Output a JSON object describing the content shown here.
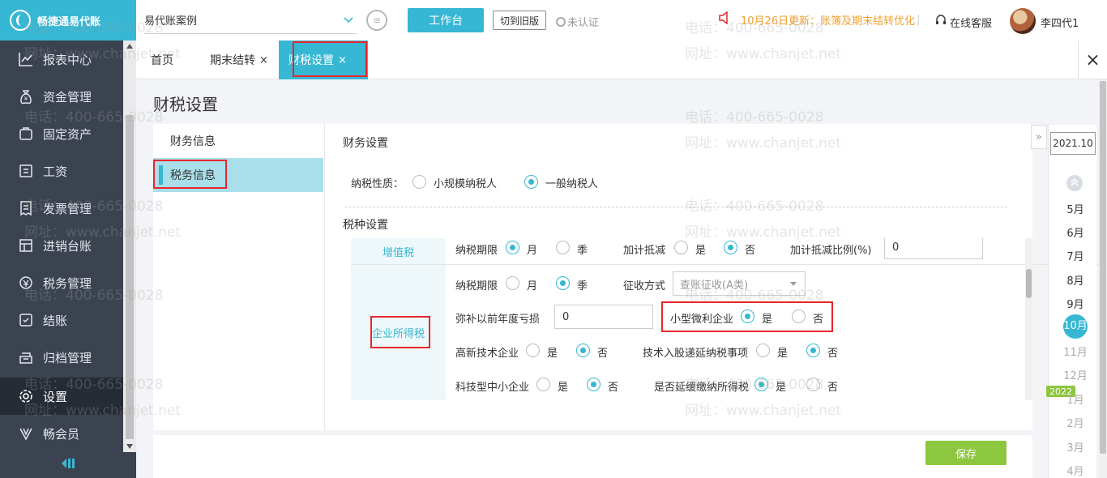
{
  "brand": {
    "name": "畅捷通易代账"
  },
  "sidebar": {
    "items": [
      {
        "label": "报表中心",
        "icon": "chart-icon"
      },
      {
        "label": "资金管理",
        "icon": "money-bag-icon"
      },
      {
        "label": "固定资产",
        "icon": "asset-icon"
      },
      {
        "label": "工资",
        "icon": "wallet-icon"
      },
      {
        "label": "发票管理",
        "icon": "invoice-icon"
      },
      {
        "label": "进销台账",
        "icon": "ledger-icon"
      },
      {
        "label": "税务管理",
        "icon": "tax-icon"
      },
      {
        "label": "结账",
        "icon": "checkout-icon"
      },
      {
        "label": "归档管理",
        "icon": "archive-icon"
      },
      {
        "label": "设置",
        "icon": "gear-icon"
      },
      {
        "label": "畅会员",
        "icon": "vip-icon"
      }
    ],
    "active_index": 9
  },
  "header": {
    "company": "易代账案例",
    "workbench": "工作台",
    "old_version": "切到旧版",
    "certification": "未认证",
    "notice": "10月26日更新：账簿及期末结转优化",
    "service": "在线客服",
    "user": "李四代1"
  },
  "tabs": [
    {
      "label": "首页",
      "closable": false
    },
    {
      "label": "期末结转",
      "closable": true
    },
    {
      "label": "财税设置",
      "closable": true,
      "active": true
    }
  ],
  "page": {
    "title": "财税设置",
    "subnav": [
      "财务信息",
      "税务信息"
    ],
    "subnav_active": 1
  },
  "finance": {
    "section_title": "财务设置",
    "taxpayer_label": "纳税性质：",
    "taxpayer_options": [
      "小规模纳税人",
      "一般纳税人"
    ],
    "taxpayer_selected": 1
  },
  "tax_section_title": "税种设置",
  "vat": {
    "name": "增值税",
    "period_label": "纳税期限",
    "period_options": [
      "月",
      "季"
    ],
    "period_selected": 0,
    "deduct_label": "加计抵减",
    "deduct_options": [
      "是",
      "否"
    ],
    "deduct_selected": 1,
    "ratio_label": "加计抵减比例(%)",
    "ratio_value": "0"
  },
  "cit": {
    "name": "企业所得税",
    "period_label": "纳税期限",
    "period_options": [
      "月",
      "季"
    ],
    "period_selected": 1,
    "method_label": "征收方式",
    "method_value": "查账征收(A类)",
    "loss_label": "弥补以前年度亏损",
    "loss_value": "0",
    "small_label": "小型微利企业",
    "small_options": [
      "是",
      "否"
    ],
    "small_selected": 0,
    "hitech_label": "高新技术企业",
    "hitech_options": [
      "是",
      "否"
    ],
    "hitech_selected": 1,
    "tech_equity_label": "技术入股递延纳税事项",
    "tech_equity_options": [
      "是",
      "否"
    ],
    "tech_equity_selected": 1,
    "sme_label": "科技型中小企业",
    "sme_options": [
      "是",
      "否"
    ],
    "sme_selected": 1,
    "defer_label": "是否延缓缴纳所得税",
    "defer_options": [
      "是",
      "否"
    ],
    "defer_selected": 0
  },
  "save_label": "保存",
  "period": {
    "current": "2021.10",
    "months": [
      "5月",
      "6月",
      "7月",
      "8月",
      "9月",
      "10月",
      "11月",
      "12月",
      "1月",
      "2月",
      "3月",
      "4月"
    ],
    "current_index": 5,
    "year_badge": "2022"
  },
  "watermark": {
    "phone": "电话：400-665-0028",
    "site": "网址：www.chanjet.net"
  },
  "colors": {
    "accent": "#36b7d4",
    "sidebar": "#3b4351",
    "save": "#8dc63f",
    "notice": "#f0a030",
    "highlight": "#e8262b"
  }
}
